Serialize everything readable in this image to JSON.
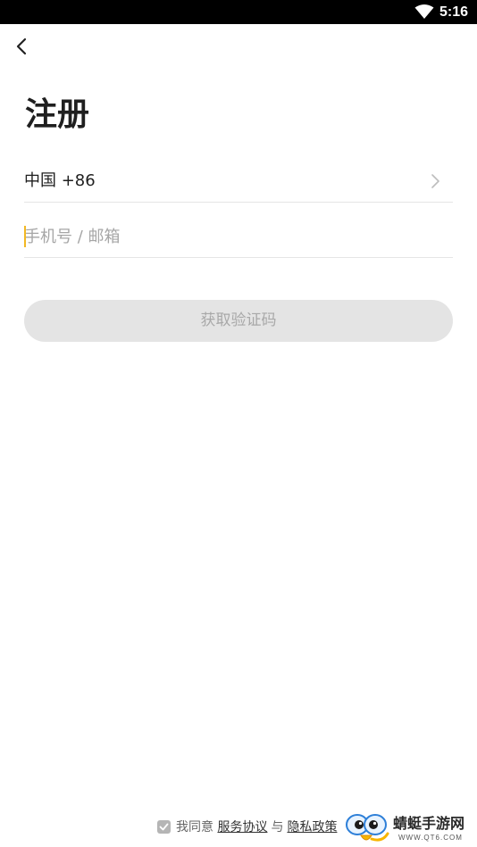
{
  "status_bar": {
    "time": "5:16",
    "wifi_icon": "wifi-icon"
  },
  "header": {
    "back_icon": "back-arrow-icon"
  },
  "page": {
    "title": "注册"
  },
  "country": {
    "label": "中国 +86",
    "chevron_icon": "chevron-right-icon"
  },
  "phone_input": {
    "value": "",
    "placeholder": "手机号 / 邮箱"
  },
  "get_code_button": {
    "label": "获取验证码"
  },
  "agreement": {
    "checked": true,
    "prefix": "我同意",
    "terms_link": "服务协议",
    "conjunction": "与",
    "privacy_link": "隐私政策"
  },
  "watermark": {
    "text": "蜻蜓手游网",
    "sub": "WWW.QT6.COM"
  },
  "colors": {
    "accent_caret": "#f2b824",
    "button_disabled_bg": "#e4e4e4",
    "button_disabled_text": "#a8a8a8",
    "divider": "#e5e5e5"
  }
}
